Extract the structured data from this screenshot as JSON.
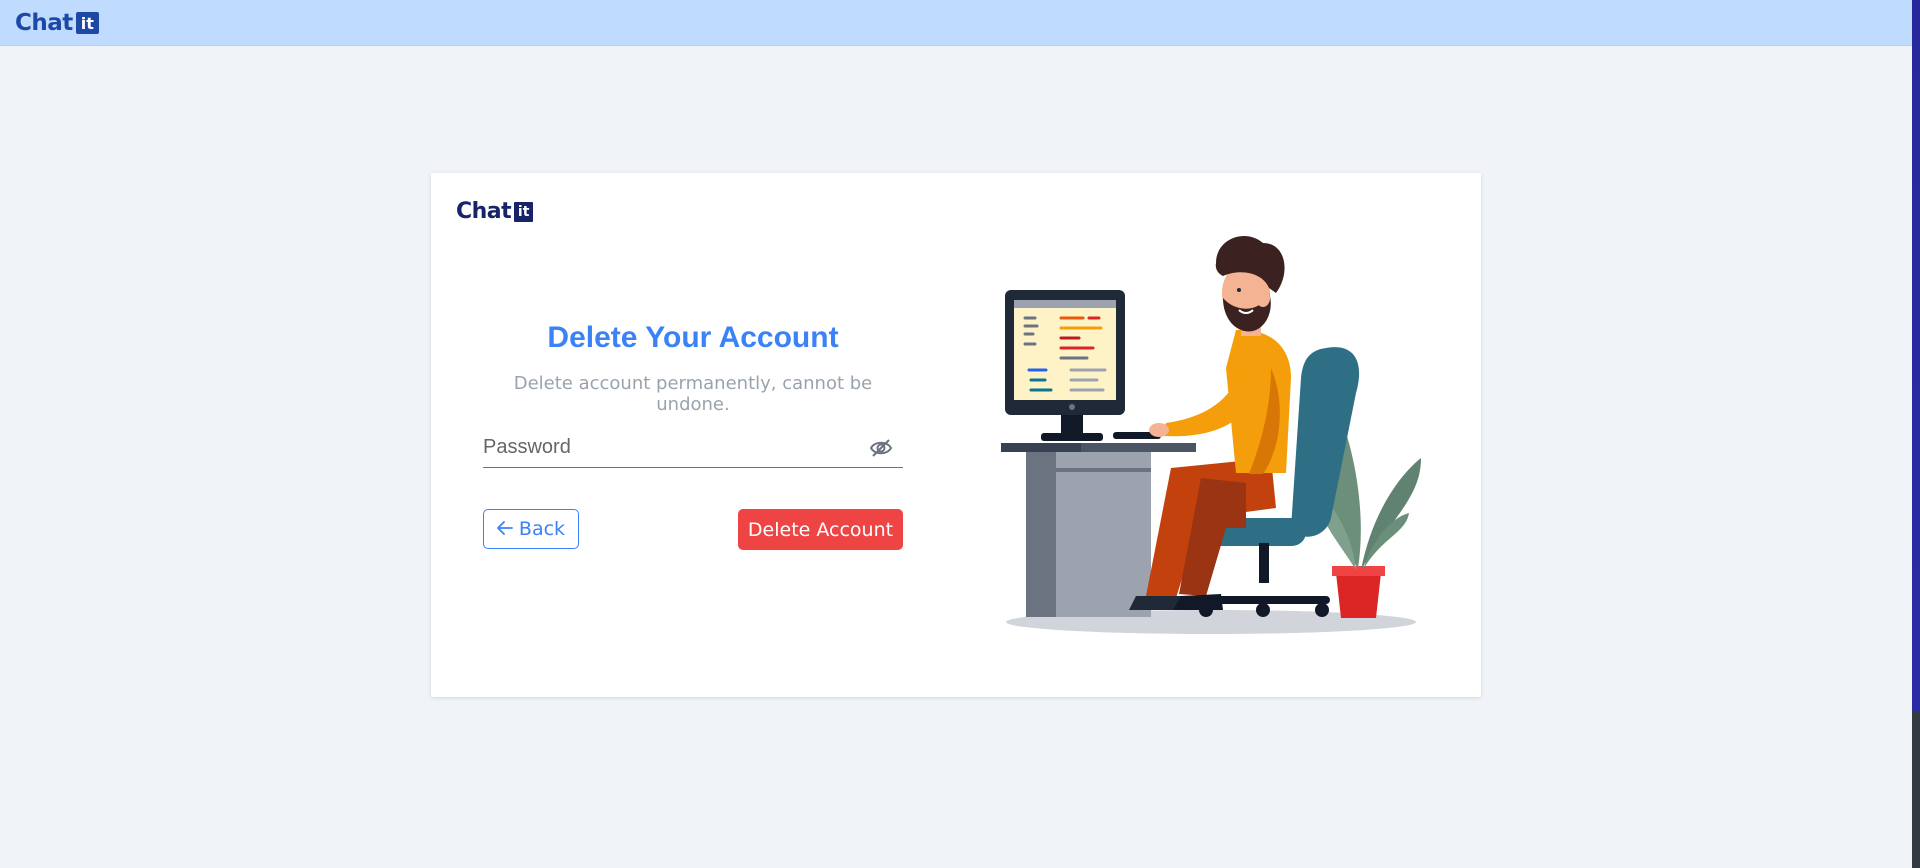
{
  "header": {
    "logo_text": "Chat",
    "logo_box": "it"
  },
  "card": {
    "logo_text": "Chat",
    "logo_box": "it",
    "title": "Delete Your Account",
    "subtitle": "Delete account permanently, cannot be undone.",
    "password": {
      "placeholder": "Password",
      "value": ""
    },
    "back_label": "Back",
    "delete_label": "Delete Account"
  },
  "colors": {
    "topbar": "#bfdbfe",
    "brand": "#1e48a8",
    "accent": "#3b82f6",
    "danger": "#ef4444"
  },
  "icons": {
    "password_toggle": "eye-off-icon",
    "back": "arrow-left-icon"
  }
}
